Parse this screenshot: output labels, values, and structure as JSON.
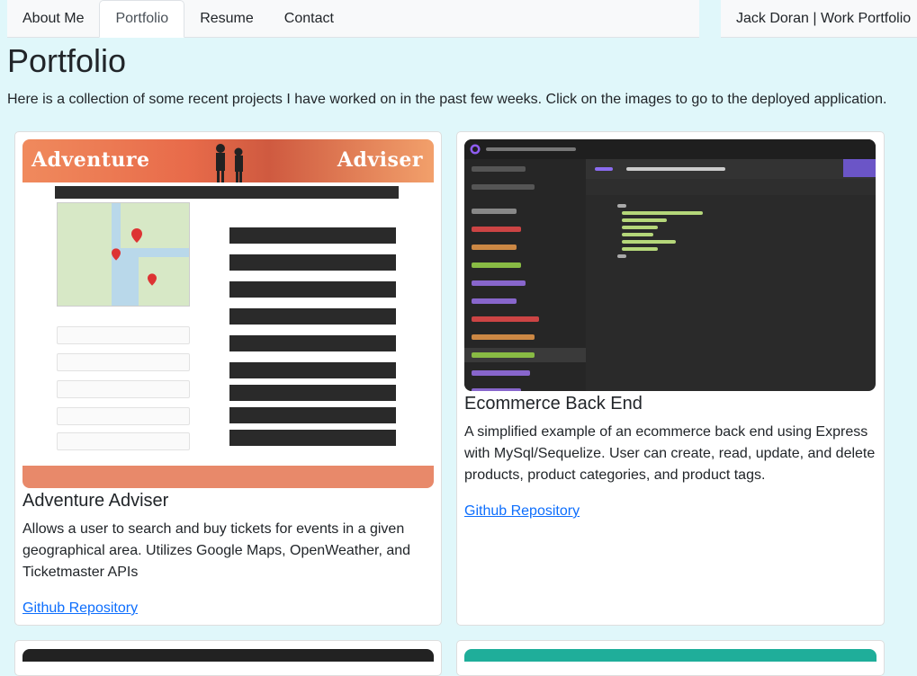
{
  "nav": {
    "tabs": [
      {
        "label": "About Me"
      },
      {
        "label": "Portfolio"
      },
      {
        "label": "Resume"
      },
      {
        "label": "Contact"
      }
    ],
    "active_tab": "Portfolio",
    "brand": "Jack Doran | Work Portfolio"
  },
  "page": {
    "title": "Portfolio",
    "intro": "Here is a collection of some recent projects I have worked on in the past few weeks. Click on the images to go to the deployed application."
  },
  "projects": [
    {
      "title": "Adventure Adviser",
      "description": "Allows a user to search and buy tickets for events in a given geographical area. Utilizes Google Maps, OpenWeather, and Ticketmaster APIs",
      "link_label": "Github Repository",
      "screenshot": {
        "header_left": "Adventure",
        "header_right": "Adviser"
      }
    },
    {
      "title": "Ecommerce Back End",
      "description": "A simplified example of an ecommerce back end using Express with MySql/Sequelize. User can create, read, update, and delete products, product categories, and product tags.",
      "link_label": "Github Repository"
    }
  ],
  "colors": {
    "background": "#e0f7fa",
    "link": "#0d6efd",
    "nav": "#f8f9fa"
  }
}
